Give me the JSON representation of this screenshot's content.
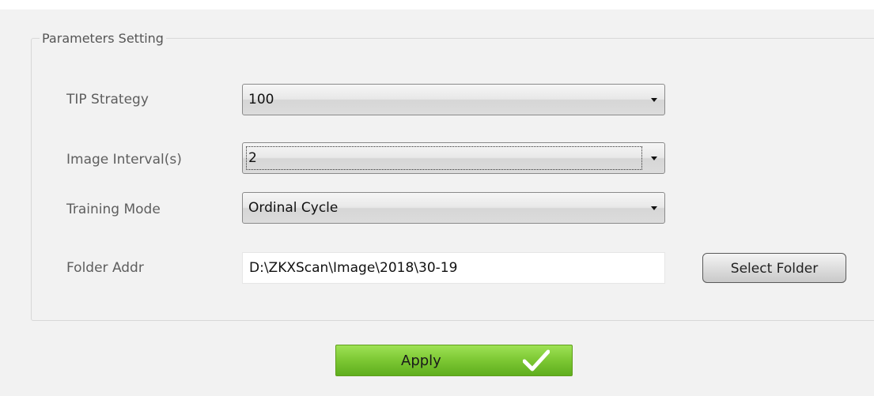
{
  "group": {
    "title": "Parameters Setting"
  },
  "tip_strategy": {
    "label": "TIP Strategy",
    "value": "100"
  },
  "image_interval": {
    "label": "Image Interval(s)",
    "value": "2"
  },
  "training_mode": {
    "label": "Training Mode",
    "value": "Ordinal Cycle"
  },
  "folder": {
    "label": "Folder Addr",
    "value": "D:\\ZKXScan\\Image\\2018\\30-19",
    "button_label": "Select Folder"
  },
  "apply": {
    "label": "Apply",
    "icon": "checkmark-icon"
  },
  "colors": {
    "apply_green": "#7cc733",
    "background": "#f2f2f2"
  }
}
